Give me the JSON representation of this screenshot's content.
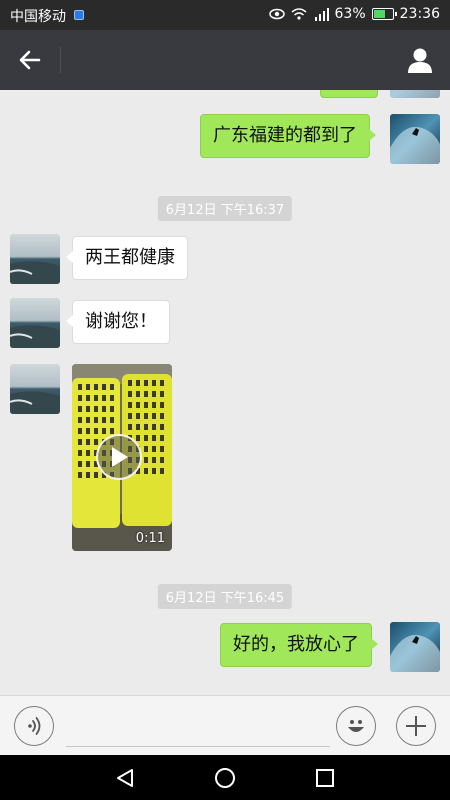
{
  "status_bar": {
    "carrier": "中国移动",
    "battery": "63%",
    "battery_level": 0.63,
    "time": "23:36"
  },
  "title_bar": {
    "back_icon": "arrow-left-icon",
    "profile_icon": "person-icon"
  },
  "messages": [
    {
      "type": "text",
      "direction": "out",
      "text": "广东福建的都到了"
    },
    {
      "type": "timestamp",
      "text": "6月12日  下午16:37"
    },
    {
      "type": "text",
      "direction": "in",
      "text": "两王都健康"
    },
    {
      "type": "text",
      "direction": "in",
      "text": "谢谢您！"
    },
    {
      "type": "video",
      "direction": "in",
      "duration": "0:11"
    },
    {
      "type": "timestamp",
      "text": "6月12日  下午16:45"
    },
    {
      "type": "text",
      "direction": "out",
      "text": "好的，我放心了"
    }
  ],
  "input_bar": {
    "voice_icon": "voice-icon",
    "emoji_icon": "smiley-icon",
    "more_icon": "plus-icon",
    "input_value": ""
  },
  "nav_bar": {
    "back_icon": "triangle-back-icon",
    "home_icon": "circle-home-icon",
    "recents_icon": "square-recents-icon"
  },
  "colors": {
    "chat_background": "#ebebeb",
    "title_bar": "#393a3f",
    "outgoing_bubble": "#a0e75a",
    "incoming_bubble": "#ffffff"
  }
}
